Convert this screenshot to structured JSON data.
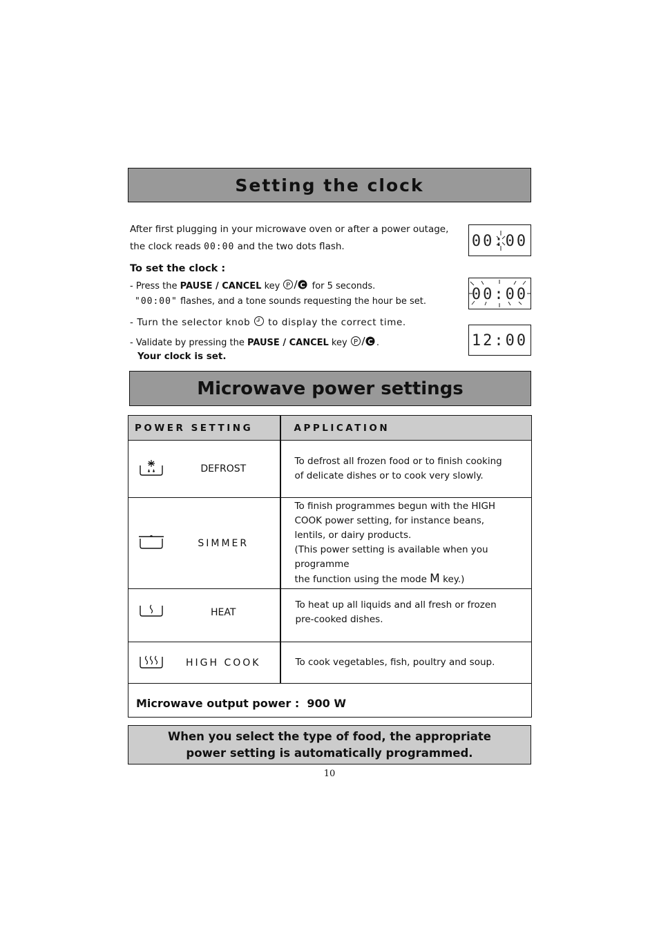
{
  "clock_section": {
    "title": "Setting the clock",
    "intro_line1": "After first plugging in your microwave oven or after a power outage,",
    "intro_line2_before": "the clock reads",
    "intro_lcd": "00:00",
    "intro_line2_after": "and the two dots flash.",
    "subheading": "To set the clock :",
    "step1_prefix": "- Press the",
    "step1_key": "PAUSE / CANCEL",
    "step1_key_word": "key",
    "step1_suffix": "for 5 seconds.",
    "step1b_lcd": "\"00:00\"",
    "step1b_text": "flashes, and a tone sounds requesting the hour be set.",
    "step2_prefix": "- Turn the selector knob",
    "step2_suffix": "to display the correct time.",
    "step3_prefix": "- Validate by pressing the",
    "step3_key": "PAUSE / CANCEL",
    "step3_key_word": "key",
    "step3_suffix": ".",
    "conclusion": "Your clock is set.",
    "displays": [
      {
        "value": "00:00",
        "state": "dots flashing"
      },
      {
        "value": "00:00",
        "state": "digits flashing"
      },
      {
        "value": "12:00",
        "state": "set"
      }
    ],
    "key_icons": [
      "pause-icon",
      "cancel-icon"
    ],
    "knob_icon": "selector-knob-icon"
  },
  "power_section": {
    "title": "Microwave power settings",
    "table": {
      "headers": [
        "POWER SETTING",
        "APPLICATION"
      ],
      "rows": [
        {
          "icon": "defrost-icon",
          "label": "DEFROST",
          "application": [
            "To defrost all frozen food or to finish cooking",
            "of delicate dishes or to cook very slowly."
          ]
        },
        {
          "icon": "simmer-icon",
          "label": "SIMMER",
          "application": [
            "To finish programmes begun with the HIGH",
            "COOK power setting, for instance beans,",
            "lentils, or dairy products.",
            "(This power setting is available when you programme"
          ],
          "application_last_before": "the function using the mode",
          "application_last_key": "M",
          "application_last_after": "key.)"
        },
        {
          "icon": "heat-icon",
          "label": "HEAT",
          "application": [
            "To heat up all liquids and all fresh or frozen",
            "pre-cooked dishes."
          ]
        },
        {
          "icon": "high-cook-icon",
          "label": "HIGH COOK",
          "application": [
            "To cook vegetables, fish, poultry and soup."
          ]
        }
      ],
      "output_label": "Microwave output power :",
      "output_value": "900 W"
    }
  },
  "note": {
    "line1": "When you select the type of food, the appropriate",
    "line2": "power setting is automatically programmed."
  },
  "page_number": "10"
}
